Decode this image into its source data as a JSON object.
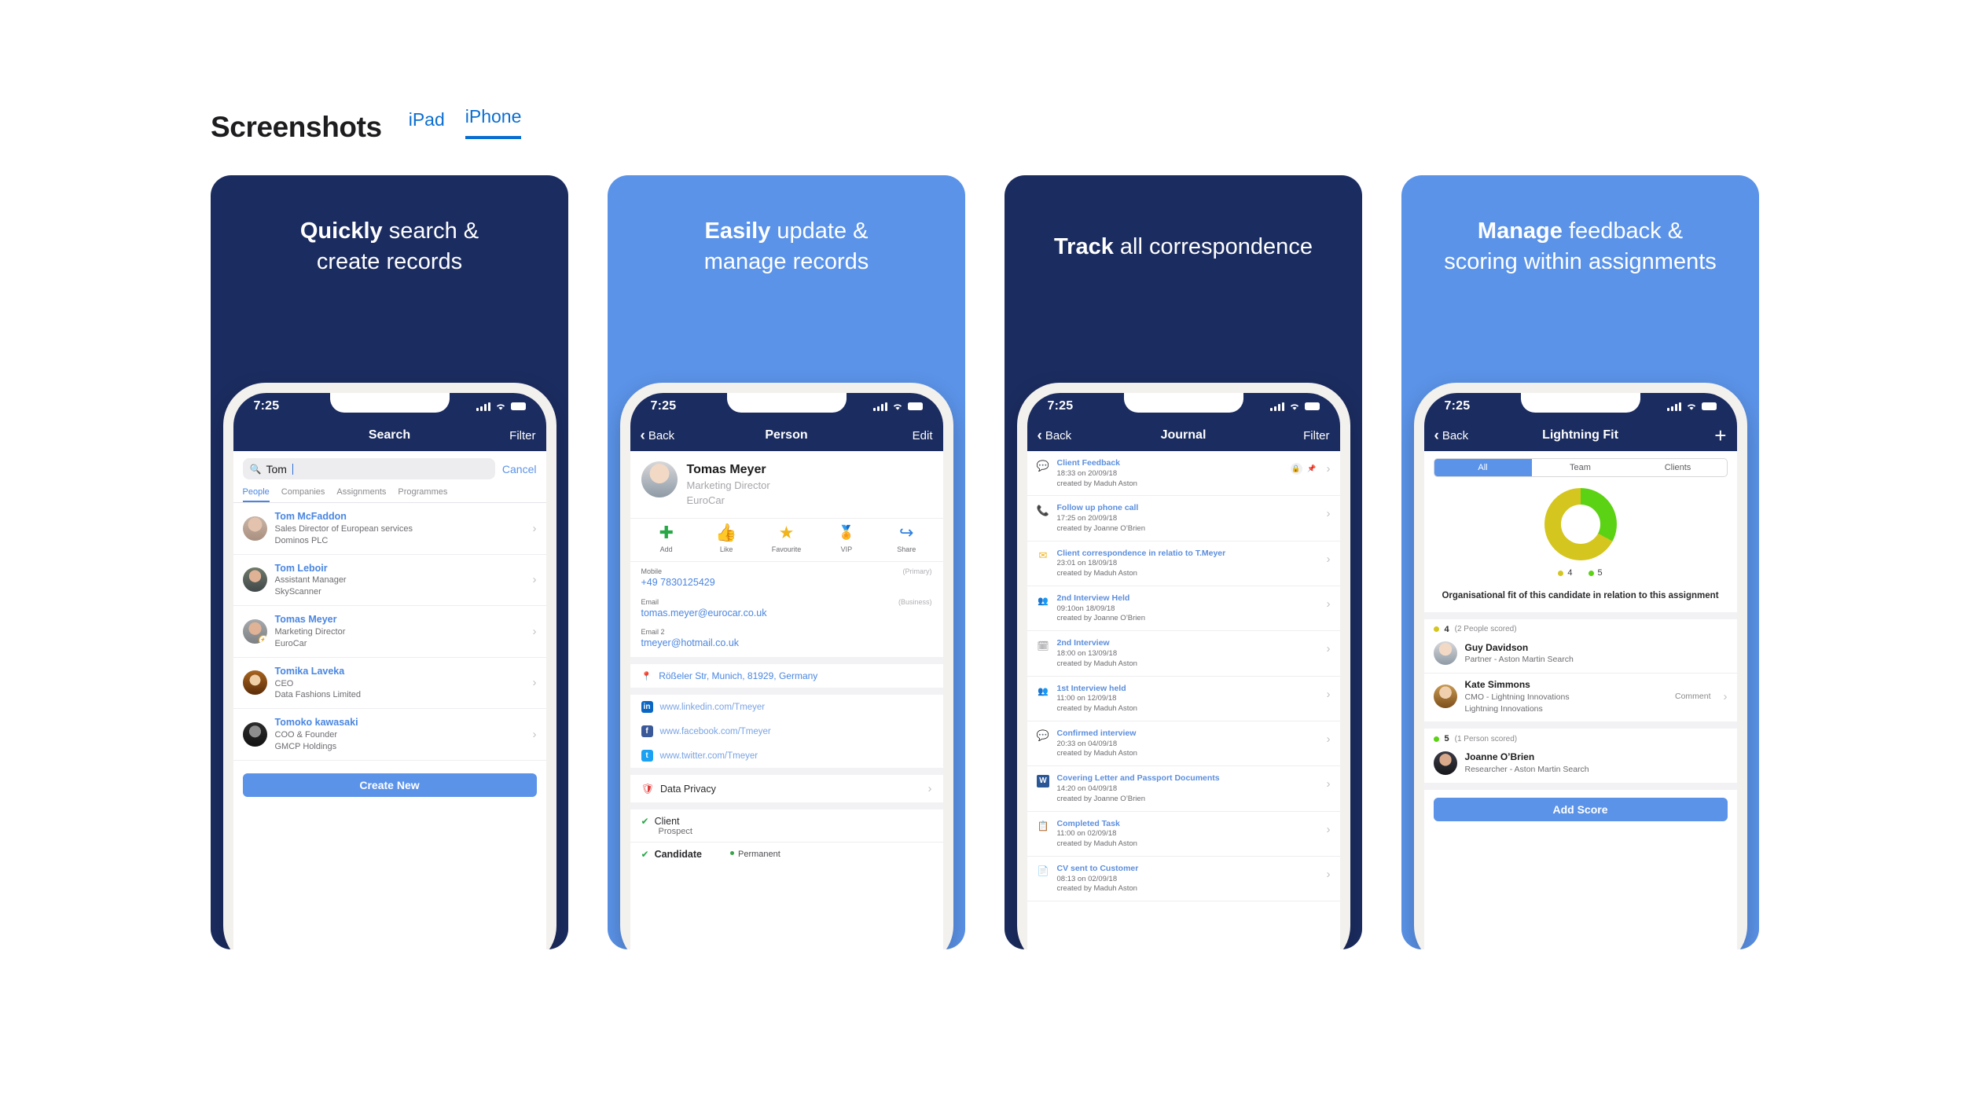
{
  "header": {
    "title": "Screenshots",
    "tabs": [
      {
        "label": "iPad",
        "active": false
      },
      {
        "label": "iPhone",
        "active": true
      }
    ]
  },
  "accent": "#0a6ed1",
  "colors": {
    "dark_card": "#1b2c60",
    "light_card": "#5b93e8",
    "nav_blue": "#1b2c60",
    "link_blue": "#4a86e0",
    "button_blue": "#5b93e8",
    "donut_yellow": "#d4c61e",
    "donut_green": "#5cd214"
  },
  "cards": [
    {
      "theme": "dark",
      "title_bold": "Quickly",
      "title_rest": " search &",
      "title_line2": "create records"
    },
    {
      "theme": "light",
      "title_bold": "Easily",
      "title_rest": " update &",
      "title_line2": "manage records"
    },
    {
      "theme": "dark",
      "title_bold": "Track",
      "title_rest": " all correspondence",
      "title_line2": ""
    },
    {
      "theme": "light",
      "title_bold": "Manage",
      "title_rest": " feedback &",
      "title_line2": "scoring within assignments"
    }
  ],
  "status_bar": {
    "time": "7:25"
  },
  "screen_search": {
    "nav": {
      "left": "",
      "title": "Search",
      "right": "Filter"
    },
    "search": {
      "value": "Tom",
      "placeholder": "Search",
      "cancel": "Cancel"
    },
    "tabs": [
      {
        "label": "People",
        "active": true
      },
      {
        "label": "Companies",
        "active": false
      },
      {
        "label": "Assignments",
        "active": false
      },
      {
        "label": "Programmes",
        "active": false
      }
    ],
    "results": [
      {
        "name": "Tom McFaddon",
        "role": "Sales Director of European services",
        "company": "Dominos PLC",
        "vip": false
      },
      {
        "name": "Tom Leboir",
        "role": "Assistant Manager",
        "company": "SkyScanner",
        "vip": false
      },
      {
        "name": "Tomas Meyer",
        "role": "Marketing Director",
        "company": "EuroCar",
        "vip": true
      },
      {
        "name": "Tomika Laveka",
        "role": "CEO",
        "company": "Data Fashions Limited",
        "vip": false
      },
      {
        "name": "Tomoko kawasaki",
        "role": "COO & Founder",
        "company": "GMCP Holdings",
        "vip": false
      }
    ],
    "create_button": "Create New"
  },
  "screen_person": {
    "nav": {
      "left": "Back",
      "title": "Person",
      "right": "Edit"
    },
    "name": "Tomas Meyer",
    "role": "Marketing Director",
    "company": "EuroCar",
    "actions": [
      {
        "label": "Add",
        "icon": "plus-icon",
        "glyph": "✚",
        "color": "#27a745"
      },
      {
        "label": "Like",
        "icon": "thumbs-up-icon",
        "glyph": "👍",
        "color": "#9a9a9f"
      },
      {
        "label": "Favourite",
        "icon": "star-icon",
        "glyph": "★",
        "color": "#f0b41c"
      },
      {
        "label": "VIP",
        "icon": "award-icon",
        "glyph": "🏅",
        "color": "#4a4a4f"
      },
      {
        "label": "Share",
        "icon": "share-icon",
        "glyph": "↪",
        "color": "#2f7fe0"
      }
    ],
    "fields": [
      {
        "label": "Mobile",
        "tag": "(Primary)",
        "value": "+49 7830125429"
      },
      {
        "label": "Email",
        "tag": "(Business)",
        "value": "tomas.meyer@eurocar.co.uk"
      },
      {
        "label": "Email 2",
        "tag": "",
        "value": "tmeyer@hotmail.co.uk"
      }
    ],
    "address": "Rößeler Str, Munich, 81929, Germany",
    "social": [
      {
        "network": "linkedin",
        "mark": "in",
        "url": "www.linkedin.com/Tmeyer"
      },
      {
        "network": "facebook",
        "mark": "f",
        "url": "www.facebook.com/Tmeyer"
      },
      {
        "network": "twitter",
        "mark": "t",
        "url": "www.twitter.com/Tmeyer"
      }
    ],
    "data_privacy": "Data Privacy",
    "client_label": "Client",
    "client_status": "Prospect",
    "candidate_label": "Candidate",
    "candidate_type": "Permanent"
  },
  "screen_journal": {
    "nav": {
      "left": "Back",
      "title": "Journal",
      "right": "Filter"
    },
    "entries": [
      {
        "icon": "chat-icon",
        "glyph": "💬",
        "color": "#3fa45a",
        "title": "Client Feedback",
        "time": "18:33 on 20/09/18",
        "author": "created by Maduh Aston",
        "badges": [
          "lock-icon",
          "pin-icon"
        ]
      },
      {
        "icon": "phone-icon",
        "glyph": "📞",
        "color": "#3b7fd4",
        "title": "Follow up phone call",
        "time": "17:25 on 20/09/18",
        "author": "created by Joanne O’Brien",
        "badges": []
      },
      {
        "icon": "envelope-icon",
        "glyph": "✉",
        "color": "#f0b41c",
        "title": "Client correspondence in relatio to T.Meyer",
        "time": "23:01 on 18/09/18",
        "author": "created by Maduh Aston",
        "badges": []
      },
      {
        "icon": "people-icon",
        "glyph": "👥",
        "color": "#3b5c9c",
        "title": "2nd Interview Held",
        "time": "09:10on 18/09/18",
        "author": "created by Joanne O’Brien",
        "badges": []
      },
      {
        "icon": "calendar-icon",
        "glyph": "🗓",
        "color": "#8a8a8e",
        "title": "2nd Interview",
        "time": "18:00 on 13/09/18",
        "author": "created by Maduh Aston",
        "badges": []
      },
      {
        "icon": "interview-icon",
        "glyph": "👤",
        "color": "#3b5c9c",
        "title": "1st Interview held",
        "time": "11:00 on 12/09/18",
        "author": "created by Maduh Aston",
        "badges": []
      },
      {
        "icon": "comments-icon",
        "glyph": "💬",
        "color": "#2f6fd0",
        "title": "Confirmed interview",
        "time": "20:33 on 04/09/18",
        "author": "created by Maduh Aston",
        "badges": []
      },
      {
        "icon": "word-doc-icon",
        "glyph": "W",
        "color": "#2b5797",
        "title": "Covering Letter and Passport Documents",
        "time": "14:20 on 04/09/18",
        "author": "created by Joanne O’Brien",
        "badges": []
      },
      {
        "icon": "clipboard-check-icon",
        "glyph": "📋",
        "color": "#8a8a8e",
        "title": "Completed Task",
        "time": "11:00 on 02/09/18",
        "author": "created by Maduh Aston",
        "badges": []
      },
      {
        "icon": "cv-send-icon",
        "glyph": "📄",
        "color": "#8a8a8e",
        "title": "CV sent to Customer",
        "time": "08:13 on 02/09/18",
        "author": "created by Maduh Aston",
        "badges": []
      }
    ]
  },
  "screen_fit": {
    "nav": {
      "left": "Back",
      "title": "Lightning Fit",
      "right": "add-icon"
    },
    "segments": [
      {
        "label": "All",
        "active": true
      },
      {
        "label": "Team",
        "active": false
      },
      {
        "label": "Clients",
        "active": false
      }
    ],
    "caption": "Organisational fit of this candidate in relation to this assignment",
    "groups": [
      {
        "score": "4",
        "dot": "yellow",
        "count": "(2 People scored)",
        "people": [
          {
            "name": "Guy Davidson",
            "role": "Partner - Aston Martin Search",
            "company": "",
            "action": ""
          },
          {
            "name": "Kate Simmons",
            "role": "CMO - Lightning Innovations",
            "company": "Lightning Innovations",
            "action": "Comment"
          }
        ]
      },
      {
        "score": "5",
        "dot": "green",
        "count": "(1 Person scored)",
        "people": [
          {
            "name": "Joanne O’Brien",
            "role": "Researcher - Aston Martin Search",
            "company": "",
            "action": ""
          }
        ]
      }
    ],
    "add_score_button": "Add Score",
    "chart_data": {
      "type": "pie",
      "title": "Organisational fit",
      "categories": [
        "4",
        "5"
      ],
      "values": [
        2,
        1
      ],
      "colors": [
        "#d4c61e",
        "#5cd214"
      ],
      "legend": [
        "4",
        "5"
      ],
      "legend_position": "bottom"
    }
  }
}
